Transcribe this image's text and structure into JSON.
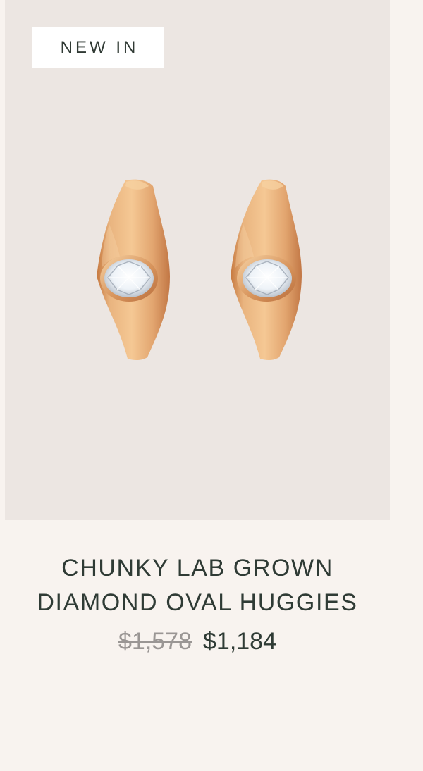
{
  "product": {
    "badge": "NEW IN",
    "title_line_1": "CHUNKY LAB GROWN",
    "title_line_2": "DIAMOND OVAL HUGGIES",
    "compare_at_price": "$1,578",
    "price": "$1,184",
    "image_description_icon": "gold-oval-diamond-huggie-earrings"
  },
  "colors": {
    "page_background": "#f8f3ef",
    "image_background": "#ece6e2",
    "title_text": "#2f3b35",
    "strikethrough_price": "#9a9694",
    "gold": "#d9a06a",
    "diamond": "#f4f7fb"
  }
}
